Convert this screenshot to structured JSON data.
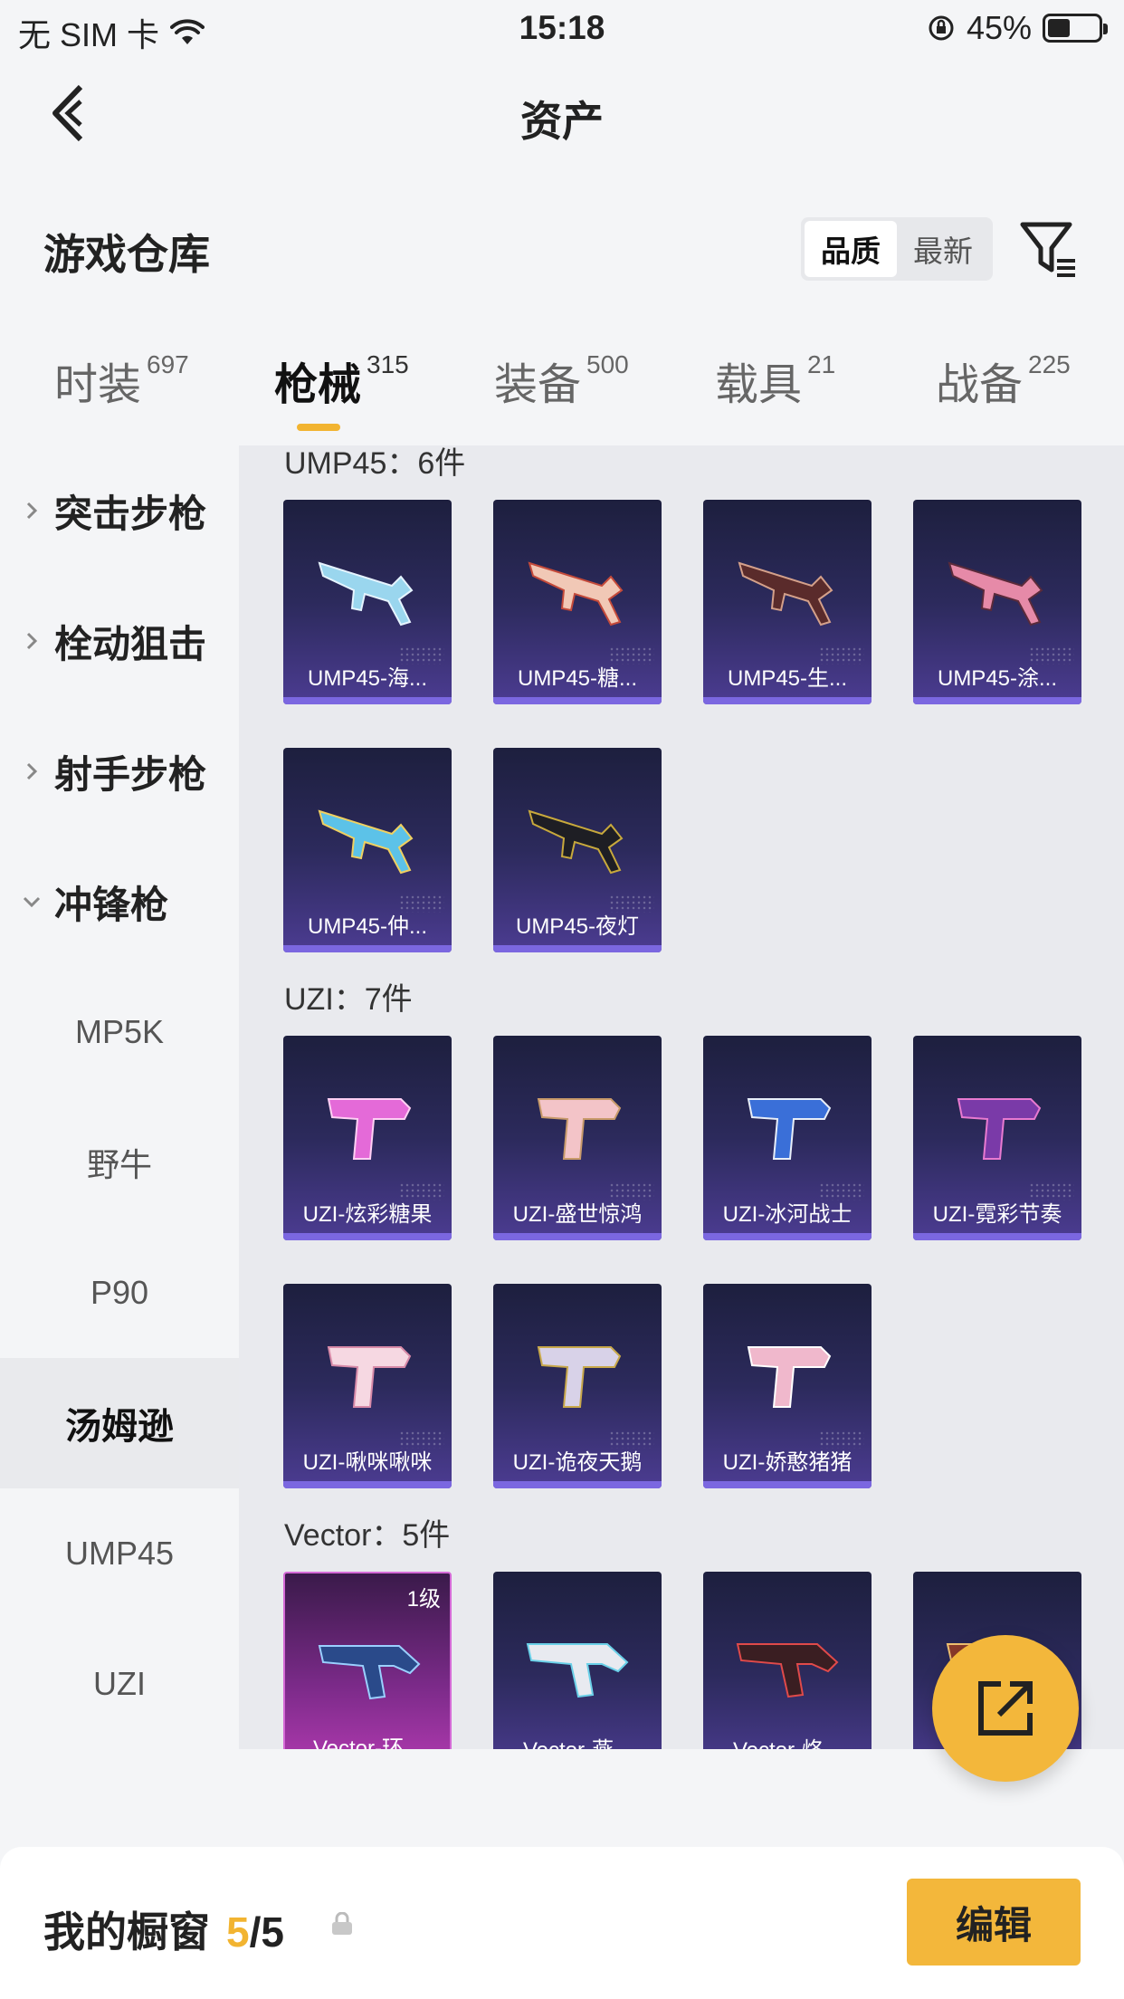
{
  "status_bar": {
    "carrier": "无 SIM 卡",
    "time": "15:18",
    "battery": "45%",
    "battery_level": 0.45
  },
  "nav": {
    "title": "资产",
    "back_icon": "chevron-left-icon"
  },
  "section": {
    "title": "游戏仓库",
    "sort_options": [
      "品质",
      "最新"
    ],
    "sort_selected": "品质",
    "filter_icon": "filter-icon"
  },
  "category_tabs": [
    {
      "label": "时装",
      "count": "697"
    },
    {
      "label": "枪械",
      "count": "315",
      "active": true
    },
    {
      "label": "装备",
      "count": "500"
    },
    {
      "label": "载具",
      "count": "21"
    },
    {
      "label": "战备",
      "count": "225"
    }
  ],
  "sidenav": {
    "parents": [
      {
        "label": "突击步枪",
        "expanded": false
      },
      {
        "label": "栓动狙击",
        "expanded": false
      },
      {
        "label": "射手步枪",
        "expanded": false
      },
      {
        "label": "冲锋枪",
        "expanded": true
      }
    ],
    "children": [
      "MP5K",
      "野牛",
      "P90",
      "汤姆逊",
      "UMP45",
      "UZI"
    ],
    "selected_child": "汤姆逊"
  },
  "groups": [
    {
      "title": "UMP45：6件",
      "items": [
        "UMP45-海...",
        "UMP45-糖...",
        "UMP45-生...",
        "UMP45-涂...",
        "UMP45-仲...",
        "UMP45-夜灯"
      ]
    },
    {
      "title": "UZI：7件",
      "items": [
        "UZI-炫彩糖果",
        "UZI-盛世惊鸿",
        "UZI-冰河战士",
        "UZI-霓彩节奏",
        "UZI-啾咪啾咪",
        "UZI-诡夜天鹅",
        "UZI-娇憨猪猪"
      ]
    },
    {
      "title": "Vector：5件",
      "items": [
        "Vector-环...",
        "Vector-燕...",
        "Vector-烙...",
        "Vector-..."
      ],
      "first_level": "1级"
    }
  ],
  "fab_icon": "share-external-icon",
  "bottom_bar": {
    "title": "我的橱窗",
    "current": "5",
    "separator": "/",
    "total": "5",
    "lock_icon": "lock-icon",
    "edit_label": "编辑"
  },
  "colors": {
    "accent": "#f2b431",
    "card_top": "#1d1f3e",
    "card_bottom": "#4c3c92",
    "card_bar": "#7b67e0",
    "legendary_card": "#b43bb2"
  }
}
